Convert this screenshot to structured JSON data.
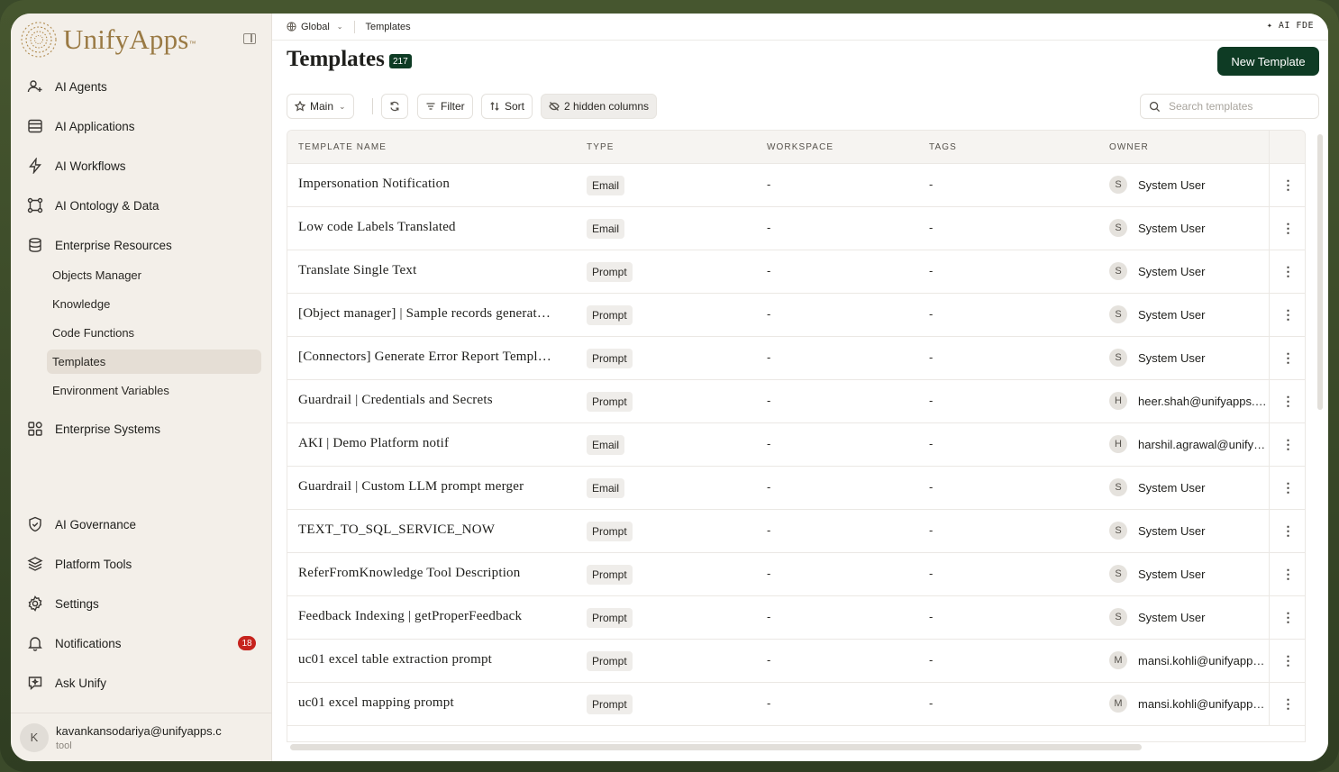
{
  "app": {
    "name": "UnifyApps",
    "tm": "™"
  },
  "sidebar": {
    "items": [
      {
        "label": "AI Agents",
        "icon": "user-plus-icon"
      },
      {
        "label": "AI Applications",
        "icon": "app-window-icon"
      },
      {
        "label": "AI Workflows",
        "icon": "lightning-icon"
      },
      {
        "label": "AI Ontology & Data",
        "icon": "graph-icon"
      },
      {
        "label": "Enterprise Resources",
        "icon": "database-icon"
      }
    ],
    "sub_items": [
      "Objects Manager",
      "Knowledge",
      "Code Functions",
      "Templates",
      "Environment Variables"
    ],
    "active_sub": "Templates",
    "systems": {
      "label": "Enterprise Systems",
      "icon": "grid-icon"
    },
    "bottom_items": [
      {
        "label": "AI Governance",
        "icon": "shield-icon"
      },
      {
        "label": "Platform Tools",
        "icon": "layers-icon"
      },
      {
        "label": "Settings",
        "icon": "gear-icon"
      },
      {
        "label": "Notifications",
        "icon": "bell-icon",
        "badge": "18"
      },
      {
        "label": "Ask Unify",
        "icon": "chat-icon"
      }
    ],
    "user": {
      "initial": "K",
      "email": "kavankansodariya@unifyapps.c",
      "role": "tool"
    }
  },
  "topbar": {
    "scope": "Global",
    "crumb": "Templates",
    "ai_label": "✦ AI FDE"
  },
  "page": {
    "title": "Templates",
    "count": "217",
    "new_button": "New Template"
  },
  "toolbar": {
    "view": "Main",
    "filter": "Filter",
    "sort": "Sort",
    "hidden_columns": "2 hidden columns",
    "search_placeholder": "Search templates"
  },
  "table": {
    "columns": [
      "TEMPLATE NAME",
      "TYPE",
      "WORKSPACE",
      "TAGS",
      "OWNER"
    ],
    "rows": [
      {
        "name": "Impersonation Notification",
        "type": "Email",
        "workspace": "-",
        "tags": "-",
        "owner_initial": "S",
        "owner": "System User"
      },
      {
        "name": "Low code Labels Translated",
        "type": "Email",
        "workspace": "-",
        "tags": "-",
        "owner_initial": "S",
        "owner": "System User"
      },
      {
        "name": "Translate Single Text",
        "type": "Prompt",
        "workspace": "-",
        "tags": "-",
        "owner_initial": "S",
        "owner": "System User"
      },
      {
        "name": "[Object manager] | Sample records generat…",
        "type": "Prompt",
        "workspace": "-",
        "tags": "-",
        "owner_initial": "S",
        "owner": "System User"
      },
      {
        "name": "[Connectors] Generate Error Report Templ…",
        "type": "Prompt",
        "workspace": "-",
        "tags": "-",
        "owner_initial": "S",
        "owner": "System User"
      },
      {
        "name": "Guardrail | Credentials and Secrets",
        "type": "Prompt",
        "workspace": "-",
        "tags": "-",
        "owner_initial": "H",
        "owner": "heer.shah@unifyapps.c…"
      },
      {
        "name": "AKI | Demo Platform notif",
        "type": "Email",
        "workspace": "-",
        "tags": "-",
        "owner_initial": "H",
        "owner": "harshil.agrawal@unify…"
      },
      {
        "name": "Guardrail | Custom LLM prompt merger",
        "type": "Email",
        "workspace": "-",
        "tags": "-",
        "owner_initial": "S",
        "owner": "System User"
      },
      {
        "name": "TEXT_TO_SQL_SERVICE_NOW",
        "type": "Prompt",
        "workspace": "-",
        "tags": "-",
        "owner_initial": "S",
        "owner": "System User"
      },
      {
        "name": "ReferFromKnowledge Tool Description",
        "type": "Prompt",
        "workspace": "-",
        "tags": "-",
        "owner_initial": "S",
        "owner": "System User"
      },
      {
        "name": "Feedback Indexing | getProperFeedback",
        "type": "Prompt",
        "workspace": "-",
        "tags": "-",
        "owner_initial": "S",
        "owner": "System User"
      },
      {
        "name": "uc01 excel table extraction prompt",
        "type": "Prompt",
        "workspace": "-",
        "tags": "-",
        "owner_initial": "M",
        "owner": "mansi.kohli@unifyapps…"
      },
      {
        "name": "uc01 excel mapping prompt",
        "type": "Prompt",
        "workspace": "-",
        "tags": "-",
        "owner_initial": "M",
        "owner": "mansi.kohli@unifyapps…"
      }
    ]
  },
  "colors": {
    "accent": "#0e3b24",
    "sidebar_bg": "#f3efe9",
    "badge": "#c6231d",
    "logo": "#9a7a44"
  }
}
